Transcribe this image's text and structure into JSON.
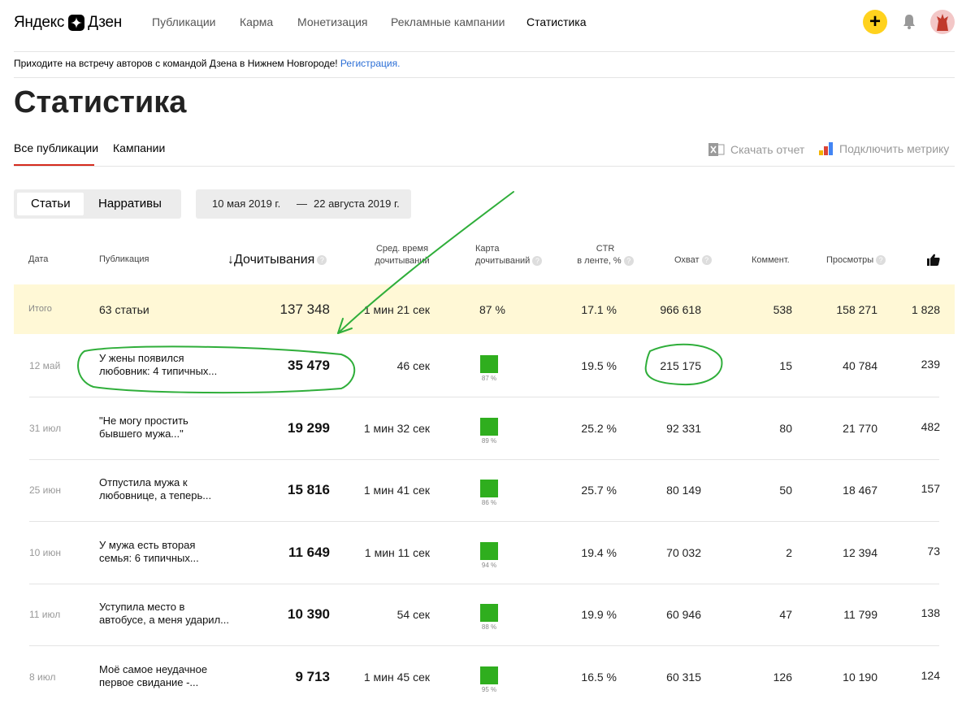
{
  "header": {
    "logo_ya": "Яндекс",
    "logo_dzen": "Дзен",
    "nav": [
      "Публикации",
      "Карма",
      "Монетизация",
      "Рекламные кампании",
      "Статистика"
    ],
    "active_nav": "Статистика",
    "plus_icon": "+",
    "accent": "#ffd21e"
  },
  "banner": {
    "text": "Приходите на встречу авторов с командой Дзена в Нижнем Новгороде!",
    "link": "Регистрация."
  },
  "page_title": "Статистика",
  "tabs": [
    "Все публикации",
    "Кампании"
  ],
  "tools": {
    "download": "Скачать отчет",
    "metrika": "Подключить метрику"
  },
  "segments": [
    "Статьи",
    "Нарративы"
  ],
  "date_range": {
    "from": "10 мая 2019 г.",
    "dash": "—",
    "to": "22 августа 2019 г."
  },
  "columns": {
    "date": "Дата",
    "pub": "Публикация",
    "reads": "Дочитывания",
    "reads_arrow": "↓",
    "avg_time_1": "Сред. время",
    "avg_time_2": "дочитываний",
    "map_1": "Карта",
    "map_2": "дочитываний",
    "ctr_1": "CTR",
    "ctr_2": "в ленте, %",
    "reach": "Охват",
    "comments": "Коммент.",
    "views": "Просмотры",
    "likes_icon": "thumbs-up-icon"
  },
  "total": {
    "label": "Итого",
    "pub": "63 статьи",
    "reads": "137 348",
    "time": "1 мин 21 сек",
    "map": "87 %",
    "ctr": "17.1 %",
    "reach": "966 618",
    "comments": "538",
    "views": "158 271",
    "likes": "1 828"
  },
  "rows": [
    {
      "date": "12 май",
      "pub1": "У жены появился",
      "pub2": "любовник: 4 типичных...",
      "reads": "35 479",
      "time": "46 сек",
      "map": "87 %",
      "ctr": "19.5 %",
      "reach": "215 175",
      "comments": "15",
      "views": "40 784",
      "likes": "239"
    },
    {
      "date": "31 июл",
      "pub1": "\"Не могу простить",
      "pub2": "бывшего мужа...\"",
      "reads": "19 299",
      "time": "1 мин 32 сек",
      "map": "89 %",
      "ctr": "25.2 %",
      "reach": "92 331",
      "comments": "80",
      "views": "21 770",
      "likes": "482"
    },
    {
      "date": "25 июн",
      "pub1": "Отпустила мужа к",
      "pub2": "любовнице, а теперь...",
      "reads": "15 816",
      "time": "1 мин 41 сек",
      "map": "86 %",
      "ctr": "25.7 %",
      "reach": "80 149",
      "comments": "50",
      "views": "18 467",
      "likes": "157"
    },
    {
      "date": "10 июн",
      "pub1": "У мужа есть вторая",
      "pub2": "семья: 6 типичных...",
      "reads": "11 649",
      "time": "1 мин 11 сек",
      "map": "94 %",
      "ctr": "19.4 %",
      "reach": "70 032",
      "comments": "2",
      "views": "12 394",
      "likes": "73"
    },
    {
      "date": "11 июл",
      "pub1": "Уступила место в",
      "pub2": "автобусе, а меня ударил...",
      "reads": "10 390",
      "time": "54 сек",
      "map": "88 %",
      "ctr": "19.9 %",
      "reach": "60 946",
      "comments": "47",
      "views": "11 799",
      "likes": "138"
    },
    {
      "date": "8 июл",
      "pub1": "Моё самое неудачное",
      "pub2": "первое свидание -...",
      "reads": "9 713",
      "time": "1 мин 45 сек",
      "map": "95 %",
      "ctr": "16.5 %",
      "reach": "60 315",
      "comments": "126",
      "views": "10 190",
      "likes": "124"
    }
  ],
  "annotation_color": "#2fae3a",
  "map_color": "#2fae1e"
}
